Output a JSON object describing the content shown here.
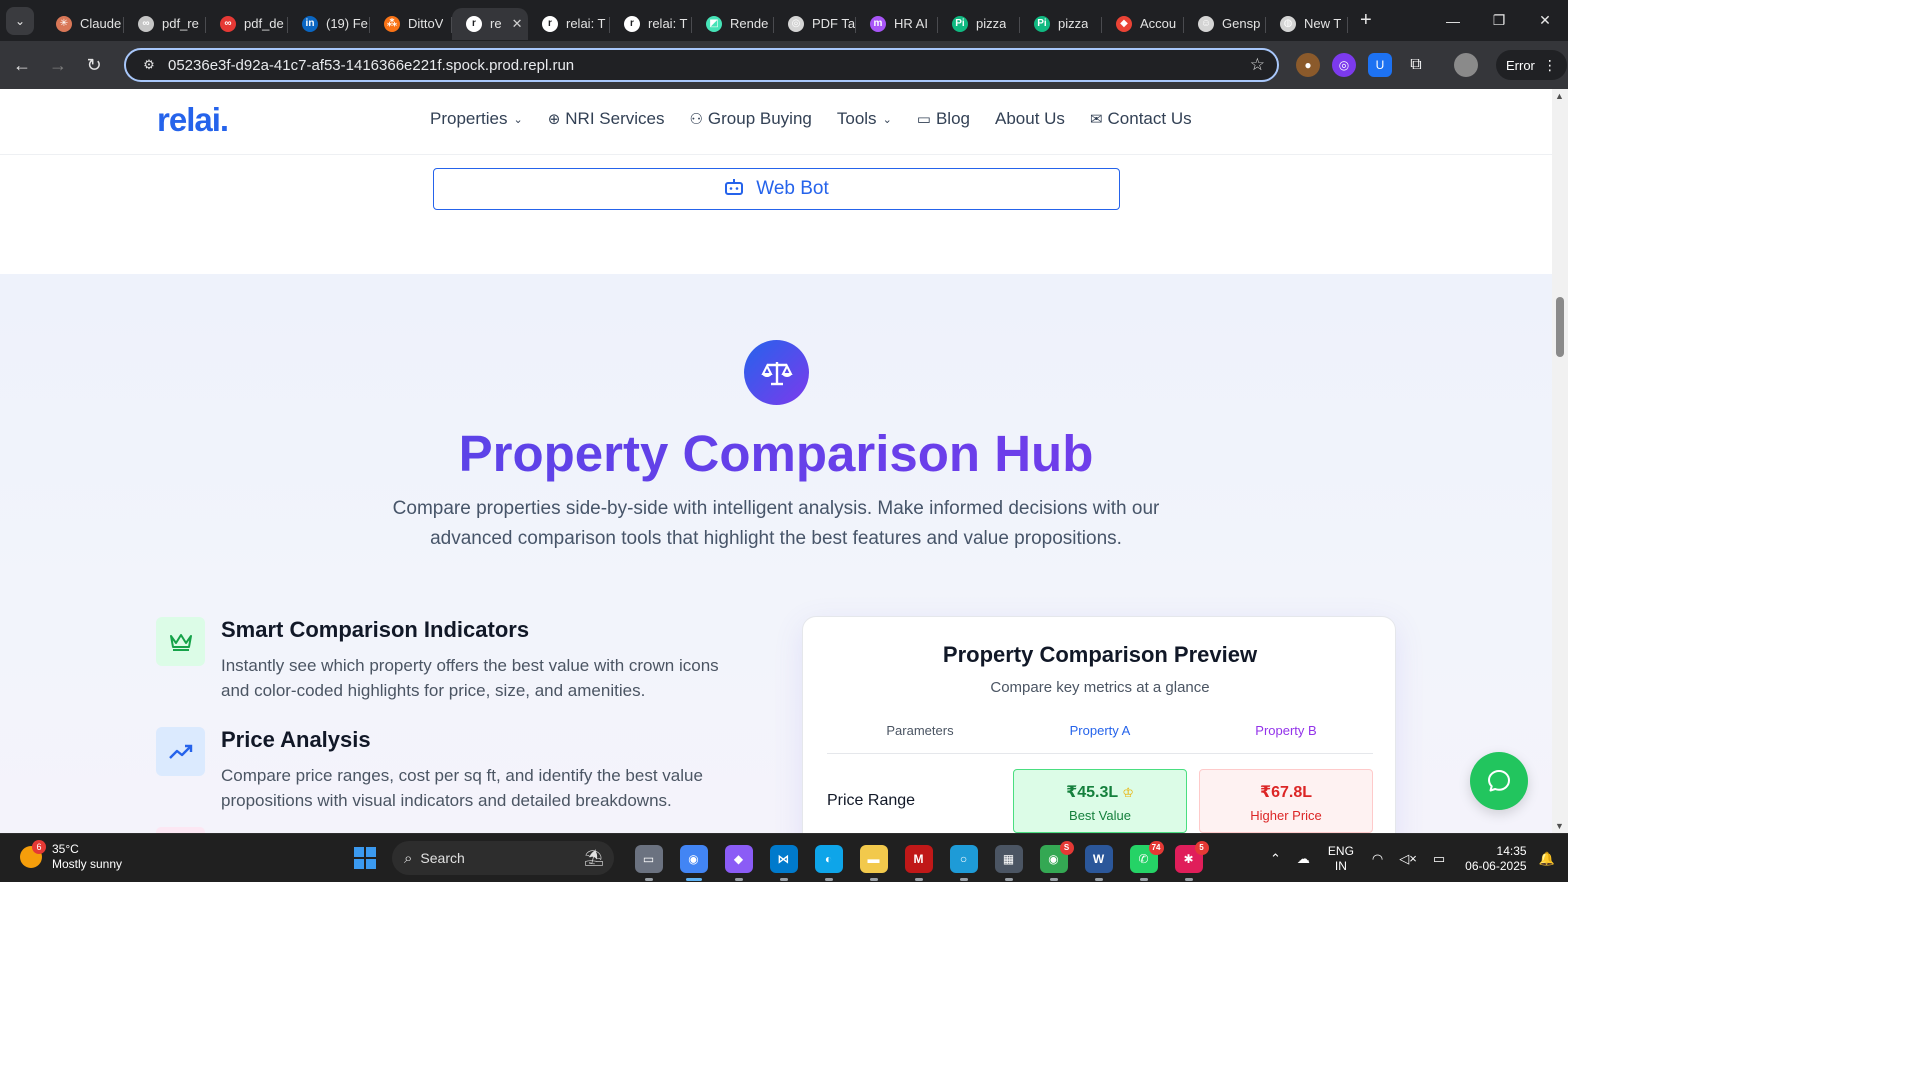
{
  "browser": {
    "tabs": [
      {
        "title": "Claude",
        "icon_color": "#d97757",
        "glyph": "✳",
        "active": false
      },
      {
        "title": "pdf_re",
        "icon_color": "#c5c5c5",
        "glyph": "∞",
        "active": false
      },
      {
        "title": "pdf_de",
        "icon_color": "#e53935",
        "glyph": "∞",
        "active": false
      },
      {
        "title": "(19) Fe",
        "icon_color": "#0a66c2",
        "glyph": "in",
        "active": false
      },
      {
        "title": "DittoV",
        "icon_color": "#f97316",
        "glyph": "⁂",
        "active": false
      },
      {
        "title": "re",
        "icon_color": "#ffffff",
        "glyph": "r",
        "active": true
      },
      {
        "title": "relai: T",
        "icon_color": "#ffffff",
        "glyph": "r",
        "active": false
      },
      {
        "title": "relai: T",
        "icon_color": "#ffffff",
        "glyph": "r",
        "active": false
      },
      {
        "title": "Rende",
        "icon_color": "#46e3b7",
        "glyph": "◩",
        "active": false
      },
      {
        "title": "PDF Ta",
        "icon_color": "#d4d4d4",
        "glyph": "◎",
        "active": false
      },
      {
        "title": "HR AI",
        "icon_color": "#a855f7",
        "glyph": "m",
        "active": false
      },
      {
        "title": "pizza",
        "icon_color": "#10b981",
        "glyph": "Pi",
        "active": false
      },
      {
        "title": "pizza",
        "icon_color": "#10b981",
        "glyph": "Pi",
        "active": false
      },
      {
        "title": "Accou",
        "icon_color": "#ea4335",
        "glyph": "◆",
        "active": false
      },
      {
        "title": "Gensp",
        "icon_color": "#d4d4d4",
        "glyph": "☺",
        "active": false
      },
      {
        "title": "New T",
        "icon_color": "#d4d4d4",
        "glyph": "◍",
        "active": false
      }
    ],
    "url": "05236e3f-d92a-41c7-af53-1416366e221f.spock.prod.repl.run",
    "profile_status": "Error"
  },
  "site": {
    "logo": "relai.",
    "nav": [
      {
        "label": "Properties",
        "icon": "",
        "dropdown": true
      },
      {
        "label": "NRI Services",
        "icon": "globe-icon",
        "dropdown": false
      },
      {
        "label": "Group Buying",
        "icon": "users-icon",
        "dropdown": false
      },
      {
        "label": "Tools",
        "icon": "",
        "dropdown": true
      },
      {
        "label": "Blog",
        "icon": "book-icon",
        "dropdown": false
      },
      {
        "label": "About Us",
        "icon": "",
        "dropdown": false
      },
      {
        "label": "Contact Us",
        "icon": "mail-icon",
        "dropdown": false
      }
    ],
    "web_bot_label": "Web Bot"
  },
  "hub": {
    "title": "Property Comparison Hub",
    "subtitle": "Compare properties side-by-side with intelligent analysis. Make informed decisions with our advanced comparison tools that highlight the best features and value propositions.",
    "features": [
      {
        "title": "Smart Comparison Indicators",
        "description": "Instantly see which property offers the best value with crown icons and color-coded highlights for price, size, and amenities.",
        "icon": "crown-icon",
        "icon_bg": "#dcfce7",
        "icon_color": "#16a34a"
      },
      {
        "title": "Price Analysis",
        "description": "Compare price ranges, cost per sq ft, and identify the best value propositions with visual indicators and detailed breakdowns.",
        "icon": "trending-up-icon",
        "icon_bg": "#dbeafe",
        "icon_color": "#2563eb"
      }
    ],
    "comparison": {
      "title": "Property Comparison Preview",
      "subtitle": "Compare key metrics at a glance",
      "headers": {
        "parameters": "Parameters",
        "property_a": "Property A",
        "property_b": "Property B"
      },
      "rows": [
        {
          "label": "Price Range",
          "a_value": "₹45.3L",
          "a_note": "Best Value",
          "b_value": "₹67.8L",
          "b_note": "Higher Price"
        }
      ]
    }
  },
  "taskbar": {
    "weather": {
      "temp": "35°C",
      "condition": "Mostly sunny",
      "badge": "6"
    },
    "search_label": "Search",
    "apps": [
      {
        "name": "task-view",
        "color": "#6b7280",
        "glyph": "▭",
        "badge": ""
      },
      {
        "name": "chrome",
        "color": "#4285f4",
        "glyph": "◉",
        "badge": "",
        "active": true
      },
      {
        "name": "copilot",
        "color": "#8b5cf6",
        "glyph": "◆",
        "badge": ""
      },
      {
        "name": "vscode",
        "color": "#007acc",
        "glyph": "⋈",
        "badge": ""
      },
      {
        "name": "edge",
        "color": "#0ea5e9",
        "glyph": "◐",
        "badge": ""
      },
      {
        "name": "file-explorer",
        "color": "#f2c94c",
        "glyph": "▬",
        "badge": ""
      },
      {
        "name": "mcafee",
        "color": "#c01818",
        "glyph": "M",
        "badge": ""
      },
      {
        "name": "cortana",
        "color": "#1e9bd7",
        "glyph": "○",
        "badge": ""
      },
      {
        "name": "store",
        "color": "#4b5563",
        "glyph": "▦",
        "badge": ""
      },
      {
        "name": "chrome-profile",
        "color": "#34a853",
        "glyph": "◉",
        "badge": "S"
      },
      {
        "name": "word",
        "color": "#2b579a",
        "glyph": "W",
        "badge": ""
      },
      {
        "name": "whatsapp",
        "color": "#25d366",
        "glyph": "✆",
        "badge": "74"
      },
      {
        "name": "slack",
        "color": "#e01e5a",
        "glyph": "✱",
        "badge": "5"
      }
    ],
    "lang": "ENG",
    "region": "IN",
    "time": "14:35",
    "date": "06-06-2025"
  }
}
